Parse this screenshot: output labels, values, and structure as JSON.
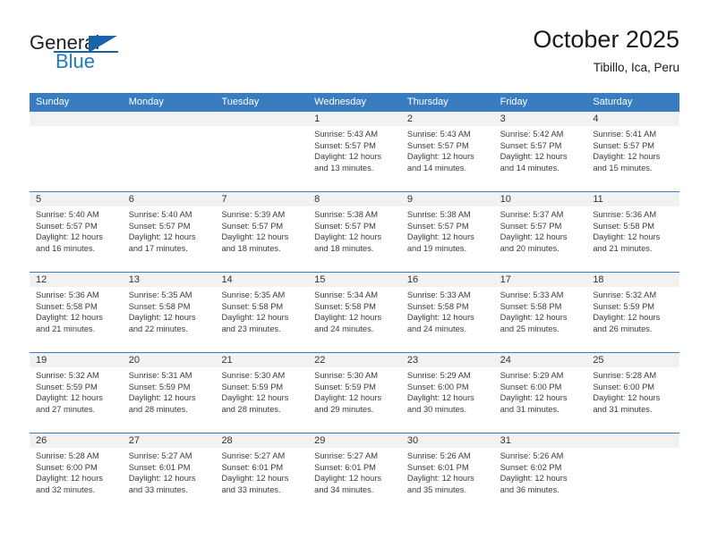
{
  "brand": {
    "name_top": "General",
    "name_bottom": "Blue",
    "logo_icon": "triangle-flag-icon",
    "accent_color": "#1565a8",
    "blue_text_color": "#1f7bc1"
  },
  "header": {
    "month_title": "October 2025",
    "location": "Tibillo, Ica, Peru"
  },
  "calendar": {
    "header_bg": "#3a7cc0",
    "day_band_bg": "#f2f2f2",
    "weekday_headers": [
      "Sunday",
      "Monday",
      "Tuesday",
      "Wednesday",
      "Thursday",
      "Friday",
      "Saturday"
    ],
    "weeks": [
      [
        {
          "day": "",
          "info": ""
        },
        {
          "day": "",
          "info": ""
        },
        {
          "day": "",
          "info": ""
        },
        {
          "day": "1",
          "info": "Sunrise: 5:43 AM\nSunset: 5:57 PM\nDaylight: 12 hours\nand 13 minutes."
        },
        {
          "day": "2",
          "info": "Sunrise: 5:43 AM\nSunset: 5:57 PM\nDaylight: 12 hours\nand 14 minutes."
        },
        {
          "day": "3",
          "info": "Sunrise: 5:42 AM\nSunset: 5:57 PM\nDaylight: 12 hours\nand 14 minutes."
        },
        {
          "day": "4",
          "info": "Sunrise: 5:41 AM\nSunset: 5:57 PM\nDaylight: 12 hours\nand 15 minutes."
        }
      ],
      [
        {
          "day": "5",
          "info": "Sunrise: 5:40 AM\nSunset: 5:57 PM\nDaylight: 12 hours\nand 16 minutes."
        },
        {
          "day": "6",
          "info": "Sunrise: 5:40 AM\nSunset: 5:57 PM\nDaylight: 12 hours\nand 17 minutes."
        },
        {
          "day": "7",
          "info": "Sunrise: 5:39 AM\nSunset: 5:57 PM\nDaylight: 12 hours\nand 18 minutes."
        },
        {
          "day": "8",
          "info": "Sunrise: 5:38 AM\nSunset: 5:57 PM\nDaylight: 12 hours\nand 18 minutes."
        },
        {
          "day": "9",
          "info": "Sunrise: 5:38 AM\nSunset: 5:57 PM\nDaylight: 12 hours\nand 19 minutes."
        },
        {
          "day": "10",
          "info": "Sunrise: 5:37 AM\nSunset: 5:57 PM\nDaylight: 12 hours\nand 20 minutes."
        },
        {
          "day": "11",
          "info": "Sunrise: 5:36 AM\nSunset: 5:58 PM\nDaylight: 12 hours\nand 21 minutes."
        }
      ],
      [
        {
          "day": "12",
          "info": "Sunrise: 5:36 AM\nSunset: 5:58 PM\nDaylight: 12 hours\nand 21 minutes."
        },
        {
          "day": "13",
          "info": "Sunrise: 5:35 AM\nSunset: 5:58 PM\nDaylight: 12 hours\nand 22 minutes."
        },
        {
          "day": "14",
          "info": "Sunrise: 5:35 AM\nSunset: 5:58 PM\nDaylight: 12 hours\nand 23 minutes."
        },
        {
          "day": "15",
          "info": "Sunrise: 5:34 AM\nSunset: 5:58 PM\nDaylight: 12 hours\nand 24 minutes."
        },
        {
          "day": "16",
          "info": "Sunrise: 5:33 AM\nSunset: 5:58 PM\nDaylight: 12 hours\nand 24 minutes."
        },
        {
          "day": "17",
          "info": "Sunrise: 5:33 AM\nSunset: 5:58 PM\nDaylight: 12 hours\nand 25 minutes."
        },
        {
          "day": "18",
          "info": "Sunrise: 5:32 AM\nSunset: 5:59 PM\nDaylight: 12 hours\nand 26 minutes."
        }
      ],
      [
        {
          "day": "19",
          "info": "Sunrise: 5:32 AM\nSunset: 5:59 PM\nDaylight: 12 hours\nand 27 minutes."
        },
        {
          "day": "20",
          "info": "Sunrise: 5:31 AM\nSunset: 5:59 PM\nDaylight: 12 hours\nand 28 minutes."
        },
        {
          "day": "21",
          "info": "Sunrise: 5:30 AM\nSunset: 5:59 PM\nDaylight: 12 hours\nand 28 minutes."
        },
        {
          "day": "22",
          "info": "Sunrise: 5:30 AM\nSunset: 5:59 PM\nDaylight: 12 hours\nand 29 minutes."
        },
        {
          "day": "23",
          "info": "Sunrise: 5:29 AM\nSunset: 6:00 PM\nDaylight: 12 hours\nand 30 minutes."
        },
        {
          "day": "24",
          "info": "Sunrise: 5:29 AM\nSunset: 6:00 PM\nDaylight: 12 hours\nand 31 minutes."
        },
        {
          "day": "25",
          "info": "Sunrise: 5:28 AM\nSunset: 6:00 PM\nDaylight: 12 hours\nand 31 minutes."
        }
      ],
      [
        {
          "day": "26",
          "info": "Sunrise: 5:28 AM\nSunset: 6:00 PM\nDaylight: 12 hours\nand 32 minutes."
        },
        {
          "day": "27",
          "info": "Sunrise: 5:27 AM\nSunset: 6:01 PM\nDaylight: 12 hours\nand 33 minutes."
        },
        {
          "day": "28",
          "info": "Sunrise: 5:27 AM\nSunset: 6:01 PM\nDaylight: 12 hours\nand 33 minutes."
        },
        {
          "day": "29",
          "info": "Sunrise: 5:27 AM\nSunset: 6:01 PM\nDaylight: 12 hours\nand 34 minutes."
        },
        {
          "day": "30",
          "info": "Sunrise: 5:26 AM\nSunset: 6:01 PM\nDaylight: 12 hours\nand 35 minutes."
        },
        {
          "day": "31",
          "info": "Sunrise: 5:26 AM\nSunset: 6:02 PM\nDaylight: 12 hours\nand 36 minutes."
        },
        {
          "day": "",
          "info": ""
        }
      ]
    ]
  }
}
